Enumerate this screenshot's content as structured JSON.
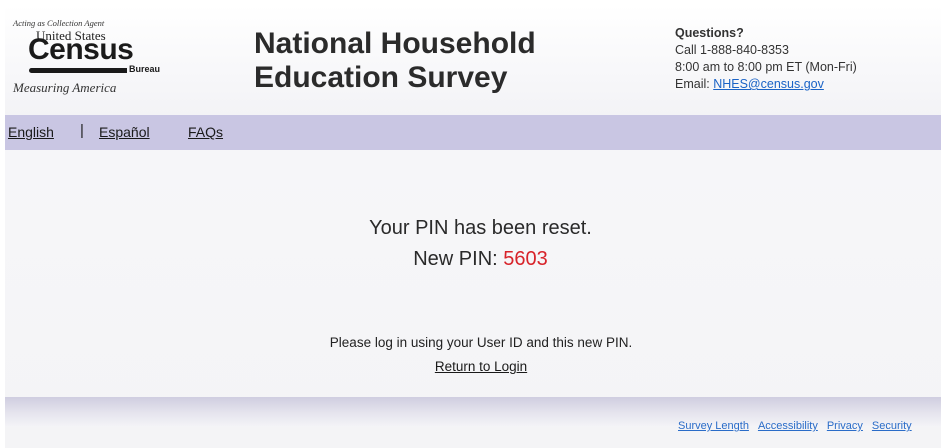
{
  "logo": {
    "acting_as": "Acting as Collection Agent",
    "united_states": "United States",
    "census": "Census",
    "bureau": "Bureau",
    "measuring": "Measuring America"
  },
  "header": {
    "title_line1": "National Household",
    "title_line2": "Education Survey"
  },
  "contact": {
    "questions": "Questions?",
    "phone": "Call 1-888-840-8353",
    "hours": "8:00 am to 8:00 pm ET (Mon-Fri)",
    "email_label": "Email: ",
    "email": "NHES@census.gov"
  },
  "nav": {
    "english": "English",
    "separator": "|",
    "espanol": "Español",
    "faqs": "FAQs"
  },
  "main": {
    "reset_message": "Your PIN has been reset.",
    "new_pin_label": "New PIN: ",
    "new_pin_value": "5603",
    "instruction": "Please log in using your User ID and this new PIN.",
    "return_link": "Return to Login"
  },
  "footer": {
    "links": [
      "Survey Length",
      "Accessibility",
      "Privacy",
      "Security"
    ]
  },
  "colors": {
    "nav_bg": "#c9c6e3",
    "pin_red": "#d8232a",
    "link_blue": "#1a63c6"
  }
}
